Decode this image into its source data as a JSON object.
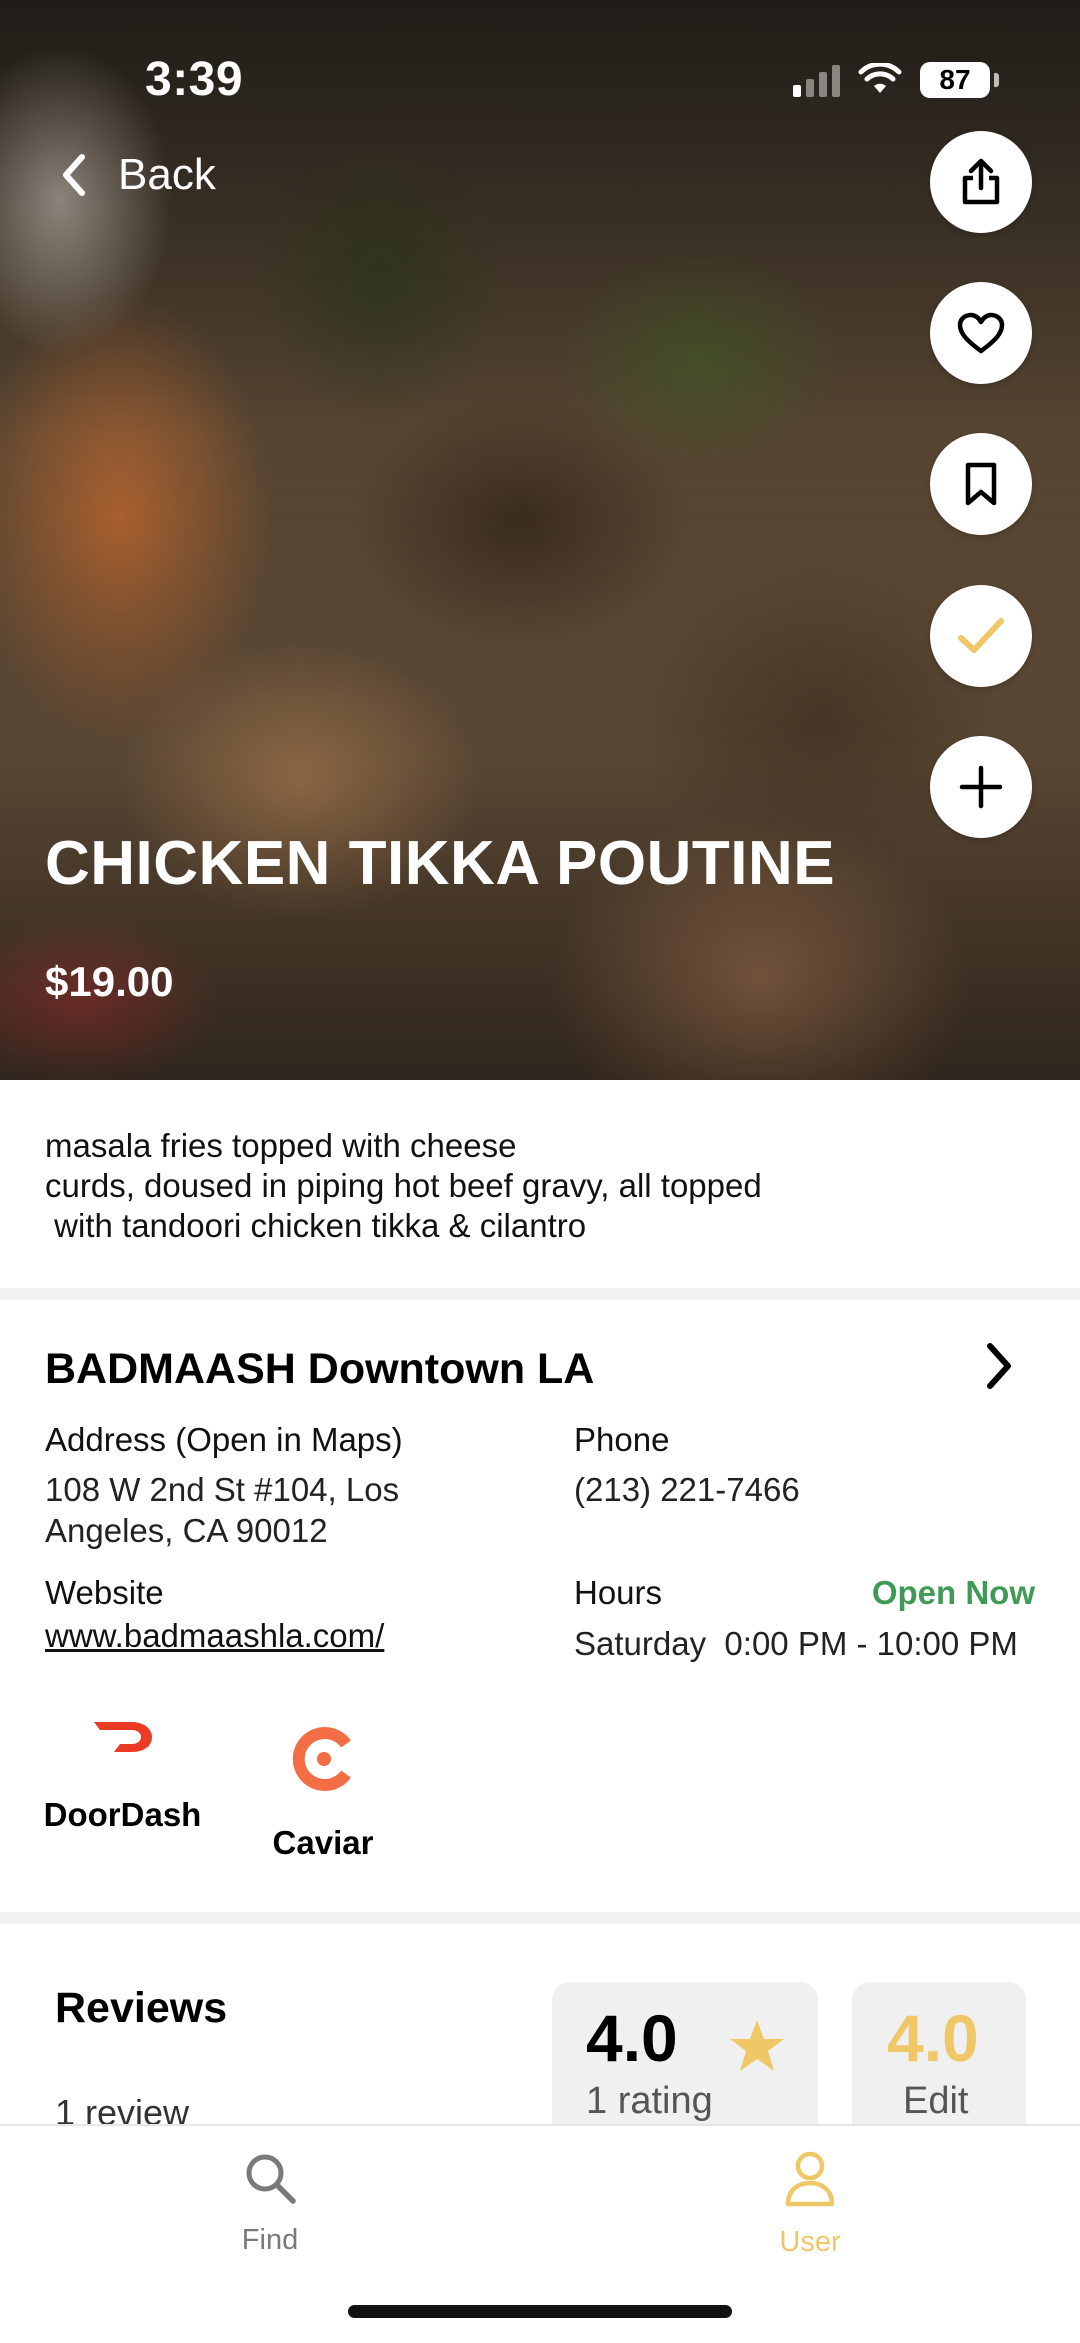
{
  "status_bar": {
    "time": "3:39",
    "battery": "87"
  },
  "nav": {
    "back_label": "Back"
  },
  "dish": {
    "name": "CHICKEN TIKKA POUTINE",
    "price": "$19.00",
    "description": "masala fries topped with cheese\ncurds, doused in piping hot beef gravy, all topped\n with tandoori chicken tikka & cilantro"
  },
  "actions": [
    "share-icon",
    "heart-icon",
    "bookmark-icon",
    "check-icon",
    "plus-icon"
  ],
  "restaurant": {
    "name": "BADMAASH Downtown LA",
    "address_label": "Address (Open in Maps)",
    "address": "108 W 2nd St #104, Los\nAngeles, CA 90012",
    "phone_label": "Phone",
    "phone": "(213) 221-7466",
    "website_label": "Website",
    "website": "www.badmaashla.com/",
    "hours_label": "Hours",
    "open_status": "Open Now",
    "hours": "Saturday  0:00 PM - 10:00 PM"
  },
  "delivery": [
    {
      "name": "DoorDash",
      "color": "#eb3b24"
    },
    {
      "name": "Caviar",
      "color": "#f36d45"
    }
  ],
  "reviews": {
    "title": "Reviews",
    "count": "1 review",
    "average": "4.0",
    "ratings_count": "1 rating",
    "my_rating": "4.0",
    "edit_label": "Edit"
  },
  "tabs": [
    {
      "label": "Find",
      "icon": "search-icon",
      "active": false
    },
    {
      "label": "User",
      "icon": "user-icon",
      "active": true
    }
  ],
  "colors": {
    "accent": "#f0c766",
    "open_green": "#3e9a55",
    "tab_inactive": "#7a7a7a"
  }
}
